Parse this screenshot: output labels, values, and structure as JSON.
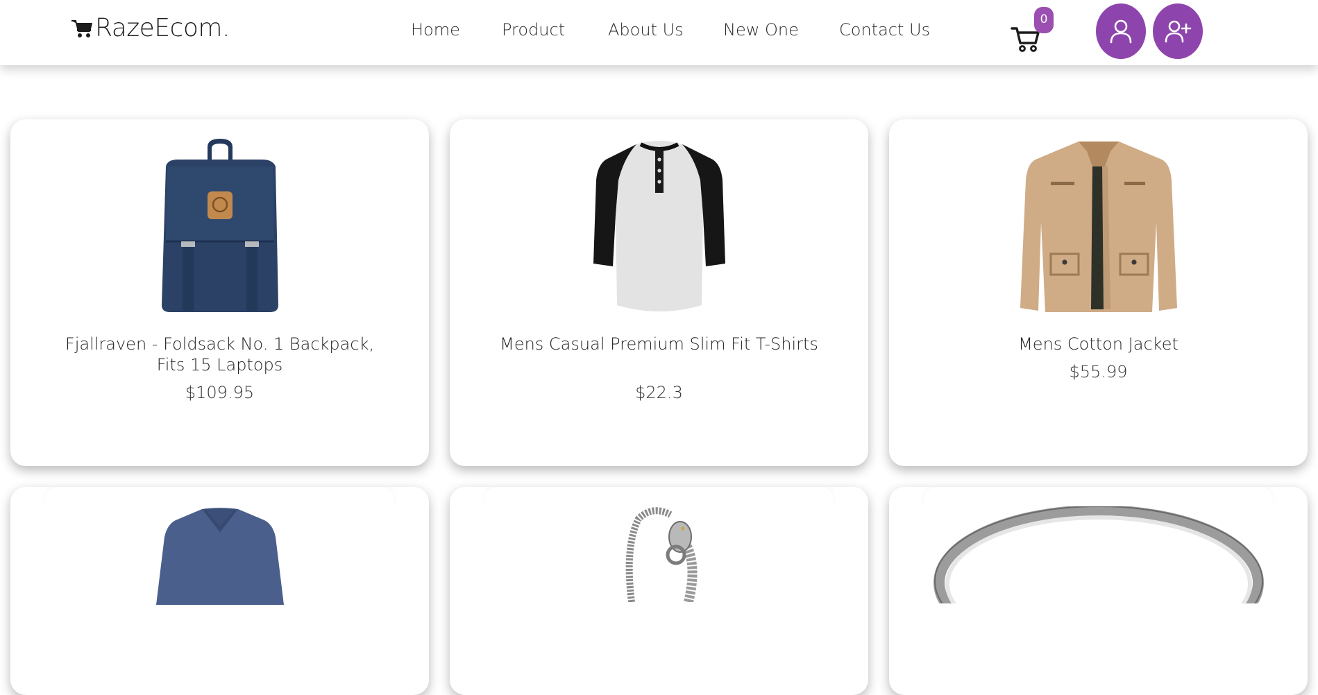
{
  "header": {
    "logo_text": "RazeEcom.",
    "nav": [
      {
        "label": "Home"
      },
      {
        "label": "Product"
      },
      {
        "label": "About Us"
      },
      {
        "label": "New One"
      },
      {
        "label": "Contact Us"
      }
    ],
    "cart_count": "0",
    "accent_color": "#8e44ad"
  },
  "products": [
    {
      "title": "Fjallraven - Foldsack No. 1 Backpack, Fits 15 Laptops",
      "price": "$109.95",
      "image": "navy-backpack"
    },
    {
      "title": "Mens Casual Premium Slim Fit T-Shirts",
      "price": "$22.3",
      "image": "raglan-henley-tshirt"
    },
    {
      "title": "Mens Cotton Jacket",
      "price": "$55.99",
      "image": "khaki-cotton-jacket"
    },
    {
      "title": "",
      "price": "",
      "image": "blue-v-neck-sweater"
    },
    {
      "title": "",
      "price": "",
      "image": "silver-dragon-bracelet"
    },
    {
      "title": "",
      "price": "",
      "image": "silver-bangle-ring"
    }
  ]
}
